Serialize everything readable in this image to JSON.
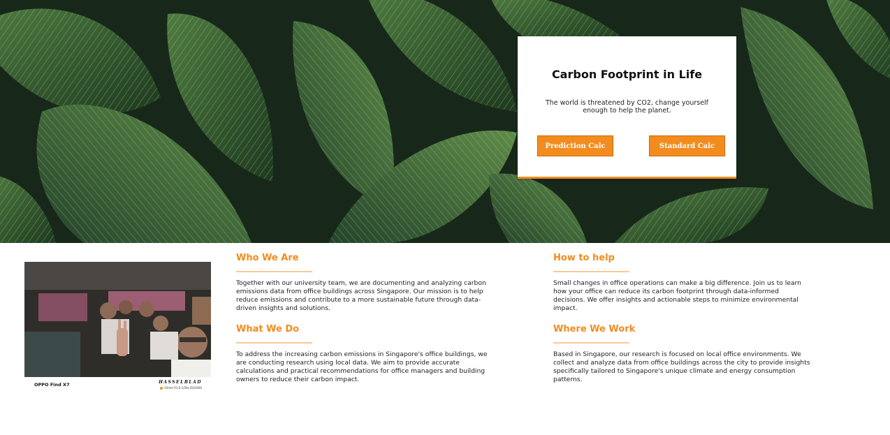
{
  "hero": {
    "title": "Carbon Footprint in Life",
    "subtitle": "The world is threatened by CO2, change yourself enough to help the planet.",
    "buttons": {
      "prediction": "Prediction Calc",
      "standard": "Standard Calc"
    },
    "background": "tropical-leaves-photo"
  },
  "photo": {
    "brand": "OPPO Find X7",
    "maker": "HASSELBLAD",
    "spec": "25mm f/1.6 1/50s ISO1600"
  },
  "sections": {
    "who": {
      "heading": "Who We Are",
      "body": "Together with our university team, we are documenting and analyzing carbon emissions data from office buildings across Singapore. Our mission is to help reduce emissions and contribute to a more sustainable future through data-driven insights and solutions."
    },
    "what": {
      "heading": "What We Do",
      "body": "To address the increasing carbon emissions in Singapore's office buildings, we are conducting research using local data. We aim to provide accurate calculations and practical recommendations for office managers and building owners to reduce their carbon impact."
    },
    "how": {
      "heading": "How to help",
      "body": "Small changes in office operations can make a big difference. Join us to learn how your office can reduce its carbon footprint through data-informed decisions. We offer insights and actionable steps to minimize environmental impact."
    },
    "where": {
      "heading": "Where We Work",
      "body": "Based in Singapore, our research is focused on local office environments. We collect and analyze data from office buildings across the city to provide insights specifically tailored to Singapore's unique climate and energy consumption patterns."
    }
  },
  "colors": {
    "accent": "#f28c1e",
    "accent_light": "#f8c99a",
    "leaf_dark": "#1f3a22",
    "leaf_mid": "#3d6b35"
  }
}
